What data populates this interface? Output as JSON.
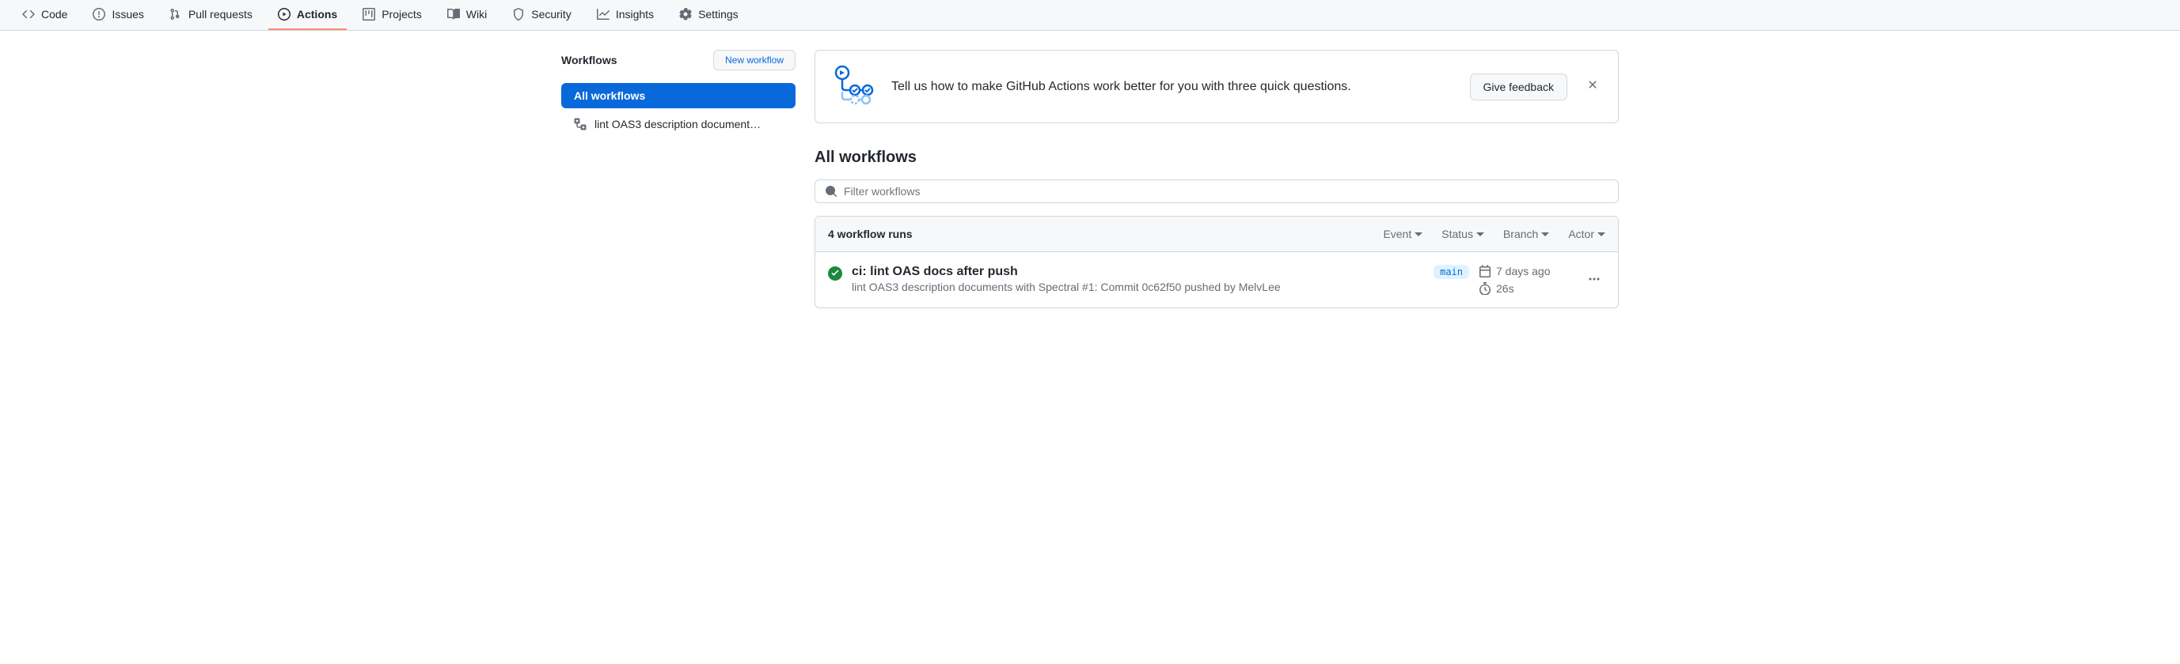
{
  "nav": {
    "tabs": [
      {
        "id": "code",
        "label": "Code"
      },
      {
        "id": "issues",
        "label": "Issues"
      },
      {
        "id": "pulls",
        "label": "Pull requests"
      },
      {
        "id": "actions",
        "label": "Actions"
      },
      {
        "id": "projects",
        "label": "Projects"
      },
      {
        "id": "wiki",
        "label": "Wiki"
      },
      {
        "id": "security",
        "label": "Security"
      },
      {
        "id": "insights",
        "label": "Insights"
      },
      {
        "id": "settings",
        "label": "Settings"
      }
    ],
    "selected": "actions"
  },
  "sidebar": {
    "title": "Workflows",
    "new_button": "New workflow",
    "all_label": "All workflows",
    "workflows": [
      {
        "name": "lint OAS3 description document…"
      }
    ]
  },
  "banner": {
    "text": "Tell us how to make GitHub Actions work better for you with three quick questions.",
    "button": "Give feedback"
  },
  "page": {
    "title": "All workflows",
    "filter_placeholder": "Filter workflows"
  },
  "runs_header": {
    "count_label": "4 workflow runs",
    "filters": [
      "Event",
      "Status",
      "Branch",
      "Actor"
    ]
  },
  "runs": [
    {
      "status": "success",
      "title": "ci: lint OAS docs after push",
      "workflow": "lint OAS3 description documents with Spectral",
      "run_number": "#1",
      "trigger": "Commit 0c62f50 pushed",
      "actor_prefix": "by",
      "actor": "MelvLee",
      "branch": "main",
      "time": "7 days ago",
      "duration": "26s"
    }
  ]
}
